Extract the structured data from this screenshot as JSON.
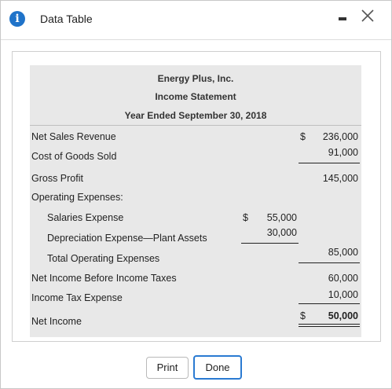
{
  "window": {
    "title": "Data Table",
    "icons": {
      "info": "info-icon",
      "minimize": "minimize-icon",
      "close": "close-icon"
    }
  },
  "statement": {
    "company": "Energy Plus, Inc.",
    "name": "Income Statement",
    "period": "Year Ended September 30, 2018",
    "lines": {
      "net_sales": {
        "label": "Net Sales Revenue",
        "dollar": "$",
        "value": "236,000"
      },
      "cogs": {
        "label": "Cost of Goods Sold",
        "value": "91,000"
      },
      "gross_profit": {
        "label": "Gross Profit",
        "value": "145,000"
      },
      "opex_header": {
        "label": "Operating Expenses:"
      },
      "salaries": {
        "label": "Salaries Expense",
        "dollar": "$",
        "value": "55,000"
      },
      "depreciation": {
        "label": "Depreciation Expense—Plant Assets",
        "value": "30,000"
      },
      "total_opex": {
        "label": "Total Operating Expenses",
        "value": "85,000"
      },
      "income_before_tax": {
        "label": "Net Income Before Income Taxes",
        "value": "60,000"
      },
      "tax": {
        "label": "Income Tax Expense",
        "value": "10,000"
      },
      "net_income": {
        "label": "Net Income",
        "dollar": "$",
        "value": "50,000"
      }
    }
  },
  "buttons": {
    "print": "Print",
    "done": "Done"
  }
}
